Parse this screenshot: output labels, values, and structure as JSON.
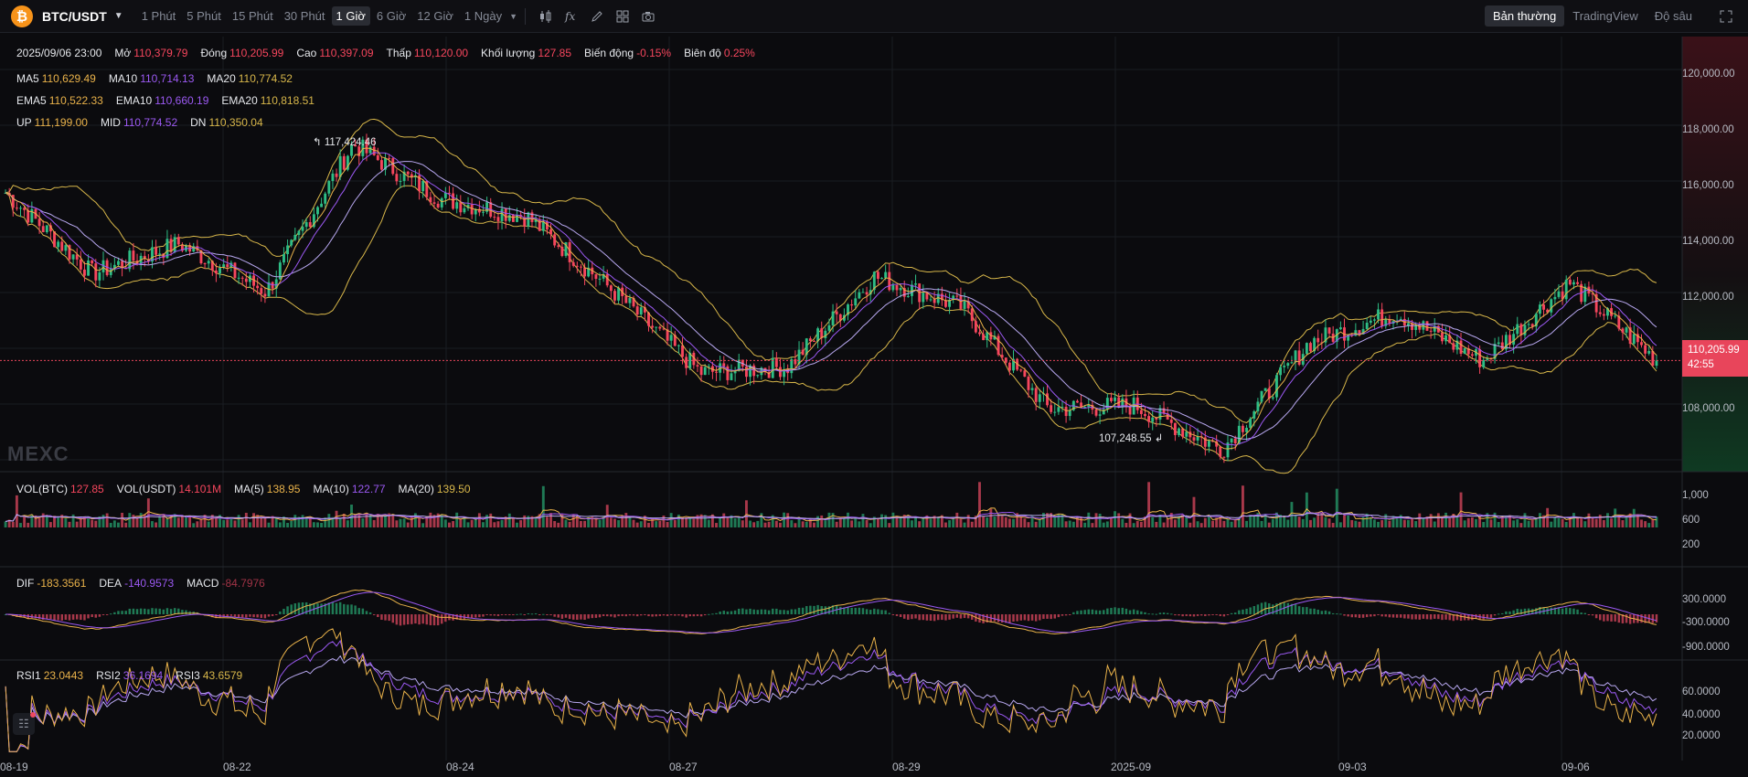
{
  "toolbar": {
    "symbol": "BTC/USDT",
    "timeframes": [
      "1 Phút",
      "5 Phút",
      "15 Phút",
      "30 Phút",
      "1 Giờ",
      "6 Giờ",
      "12 Giờ",
      "1 Ngày"
    ],
    "active_timeframe": "1 Giờ",
    "modes": [
      "Bản thường",
      "TradingView",
      "Độ sâu"
    ],
    "active_mode": "Bản thường",
    "tools": [
      "candle-type-icon",
      "indicator-icon",
      "draw-icon",
      "layout-icon",
      "camera-icon"
    ]
  },
  "ohlc": {
    "date": "2025/09/06 23:00",
    "open_label": "Mở",
    "open": "110,379.79",
    "close_label": "Đóng",
    "close": "110,205.99",
    "high_label": "Cao",
    "high": "110,397.09",
    "low_label": "Thấp",
    "low": "110,120.00",
    "volume_label": "Khối lượng",
    "volume": "127.85",
    "change_label": "Biến động",
    "change": "-0.15%",
    "amplitude_label": "Biên độ",
    "amplitude": "0.25%"
  },
  "ma": {
    "ma5_label": "MA5",
    "ma5": "110,629.49",
    "ma10_label": "MA10",
    "ma10": "110,714.13",
    "ma20_label": "MA20",
    "ma20": "110,774.52"
  },
  "ema": {
    "ema5_label": "EMA5",
    "ema5": "110,522.33",
    "ema10_label": "EMA10",
    "ema10": "110,660.19",
    "ema20_label": "EMA20",
    "ema20": "110,818.51"
  },
  "boll": {
    "up_label": "UP",
    "up": "111,199.00",
    "mid_label": "MID",
    "mid": "110,774.52",
    "dn_label": "DN",
    "dn": "110,350.04"
  },
  "price_axis": [
    "120,000.00",
    "118,000.00",
    "116,000.00",
    "114,000.00",
    "112,000.00",
    "108,000.00"
  ],
  "current_price": "110,205.99",
  "countdown": "42:55",
  "annotations": {
    "high": "117,424.46",
    "low": "107,248.55"
  },
  "watermark": "MEXC",
  "volume": {
    "vol_btc_label": "VOL(BTC)",
    "vol_btc": "127.85",
    "vol_usdt_label": "VOL(USDT)",
    "vol_usdt": "14.101M",
    "ma5_label": "MA(5)",
    "ma5": "138.95",
    "ma10_label": "MA(10)",
    "ma10": "122.77",
    "ma20_label": "MA(20)",
    "ma20": "139.50",
    "axis": [
      "1,000",
      "600",
      "200"
    ]
  },
  "macd": {
    "dif_label": "DIF",
    "dif": "-183.3561",
    "dea_label": "DEA",
    "dea": "-140.9573",
    "macd_label": "MACD",
    "macd": "-84.7976",
    "axis": [
      "300.0000",
      "-300.0000",
      "-900.0000"
    ]
  },
  "rsi": {
    "rsi1_label": "RSI1",
    "rsi1": "23.0443",
    "rsi2_label": "RSI2",
    "rsi2": "36.1694",
    "rsi3_label": "RSI3",
    "rsi3": "43.6579",
    "axis": [
      "60.0000",
      "40.0000",
      "20.0000"
    ]
  },
  "x_axis": [
    "08-19",
    "08-22",
    "08-24",
    "08-27",
    "08-29",
    "2025-09",
    "09-03",
    "09-06"
  ],
  "chart_data": {
    "type": "candlestick",
    "interval": "1h",
    "y_range": [
      106500,
      121000
    ],
    "price_path_anchors": [
      {
        "x": "08-19",
        "price": 115800
      },
      {
        "x": "08-20",
        "price": 113100
      },
      {
        "x": "08-21",
        "price": 114100
      },
      {
        "x": "08-22",
        "price": 112500
      },
      {
        "x": "08-22",
        "price": 117424.46
      },
      {
        "x": "08-23",
        "price": 115600
      },
      {
        "x": "08-24",
        "price": 115000
      },
      {
        "x": "08-25",
        "price": 112500
      },
      {
        "x": "08-26",
        "price": 109800
      },
      {
        "x": "08-27",
        "price": 110000
      },
      {
        "x": "08-28",
        "price": 113000
      },
      {
        "x": "08-29",
        "price": 112000
      },
      {
        "x": "08-30",
        "price": 108600
      },
      {
        "x": "08-31",
        "price": 108700
      },
      {
        "x": "2025-09",
        "price": 107248.55
      },
      {
        "x": "09-02",
        "price": 110800
      },
      {
        "x": "09-03",
        "price": 111800
      },
      {
        "x": "09-04",
        "price": 110200
      },
      {
        "x": "09-05",
        "price": 112800
      },
      {
        "x": "09-06",
        "price": 110205.99
      }
    ],
    "colors": {
      "up": "#2ebd85",
      "down": "#f6465d",
      "ma5": "#e9b24a",
      "ma10": "#9b59f2",
      "ma20": "#b8a8f0",
      "boll": "#d8b74a"
    }
  }
}
